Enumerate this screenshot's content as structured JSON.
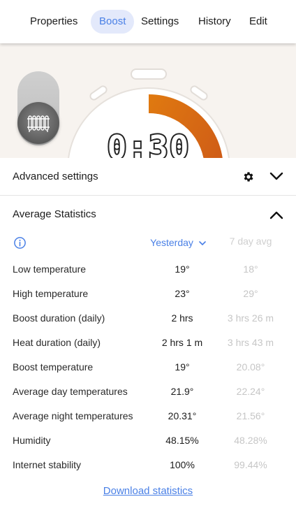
{
  "tabs": [
    {
      "label": "Properties",
      "active": false
    },
    {
      "label": "Boost",
      "active": true
    },
    {
      "label": "Settings",
      "active": false
    },
    {
      "label": "History",
      "active": false
    },
    {
      "label": "Edit",
      "active": false
    }
  ],
  "hero": {
    "timer": "0:30",
    "boost_progress": 0.5,
    "accent_color": "#d4620c",
    "radiator_icon": "radiator-icon"
  },
  "advanced": {
    "title": "Advanced settings",
    "gear_icon": "gear-icon",
    "chevron_icon": "chevron-down-icon"
  },
  "statistics": {
    "title": "Average Statistics",
    "info_icon": "info-icon",
    "period": "Yesterday",
    "avg_header": "7 day avg",
    "rows": [
      {
        "label": "Low temperature",
        "value": "19°",
        "avg": "18°"
      },
      {
        "label": "High temperature",
        "value": "23°",
        "avg": "29°"
      },
      {
        "label": "Boost duration (daily)",
        "value": "2 hrs",
        "avg": "3 hrs 26 m"
      },
      {
        "label": "Heat duration (daily)",
        "value": "2 hrs 1 m",
        "avg": "3 hrs 43 m"
      },
      {
        "label": "Boost temperature",
        "value": "19°",
        "avg": "20.08°"
      },
      {
        "label": "Average day temperatures",
        "value": "21.9°",
        "avg": "22.24°"
      },
      {
        "label": "Average night temperatures",
        "value": "20.31°",
        "avg": "21.56°"
      },
      {
        "label": "Humidity",
        "value": "48.15%",
        "avg": "48.28%"
      },
      {
        "label": "Internet stability",
        "value": "100%",
        "avg": "99.44%"
      }
    ],
    "download_label": "Download statistics"
  }
}
